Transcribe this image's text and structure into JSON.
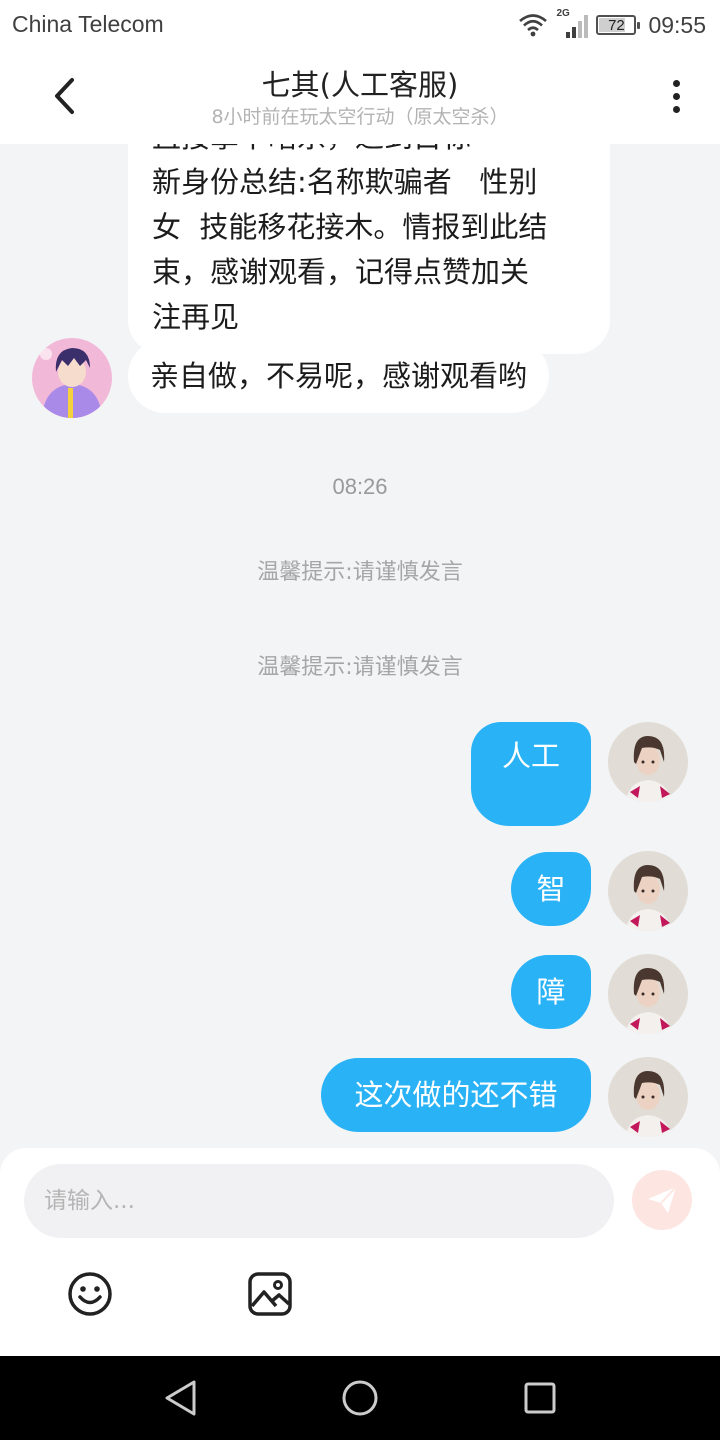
{
  "status_bar": {
    "carrier": "China Telecom",
    "network": "2G",
    "battery": "72",
    "battery_level": 0.72,
    "time": "09:55"
  },
  "header": {
    "title": "七其(人工客服)",
    "subtitle": "8小时前在玩太空行动（原太空杀）"
  },
  "messages": {
    "bubble1": {
      "partial_line": "直接拿下暗杀，达到目标",
      "lines": [
        "新身份总结:名称欺骗者   性别",
        "女  技能移花接木。情报到此结",
        "束，感谢观看，记得点赞加关",
        "注再见"
      ]
    },
    "bubble2": "亲自做，不易呢，感谢观看哟",
    "time_divider": "08:26",
    "notice1": "温馨提示:请谨慎发言",
    "notice2": "温馨提示:请谨慎发言",
    "out1": "人工",
    "out2": "智",
    "out3": "障",
    "out4": "这次做的还不错"
  },
  "input": {
    "placeholder": "请输入..."
  },
  "icons": {
    "back": "chevron-left-icon",
    "more": "more-vertical-icon",
    "send": "send-icon",
    "emoji": "smiley-icon",
    "image": "image-icon"
  },
  "colors": {
    "accent_blue": "#29b2f5",
    "background": "#f3f4f6",
    "send_inactive": "#fde6e2"
  }
}
